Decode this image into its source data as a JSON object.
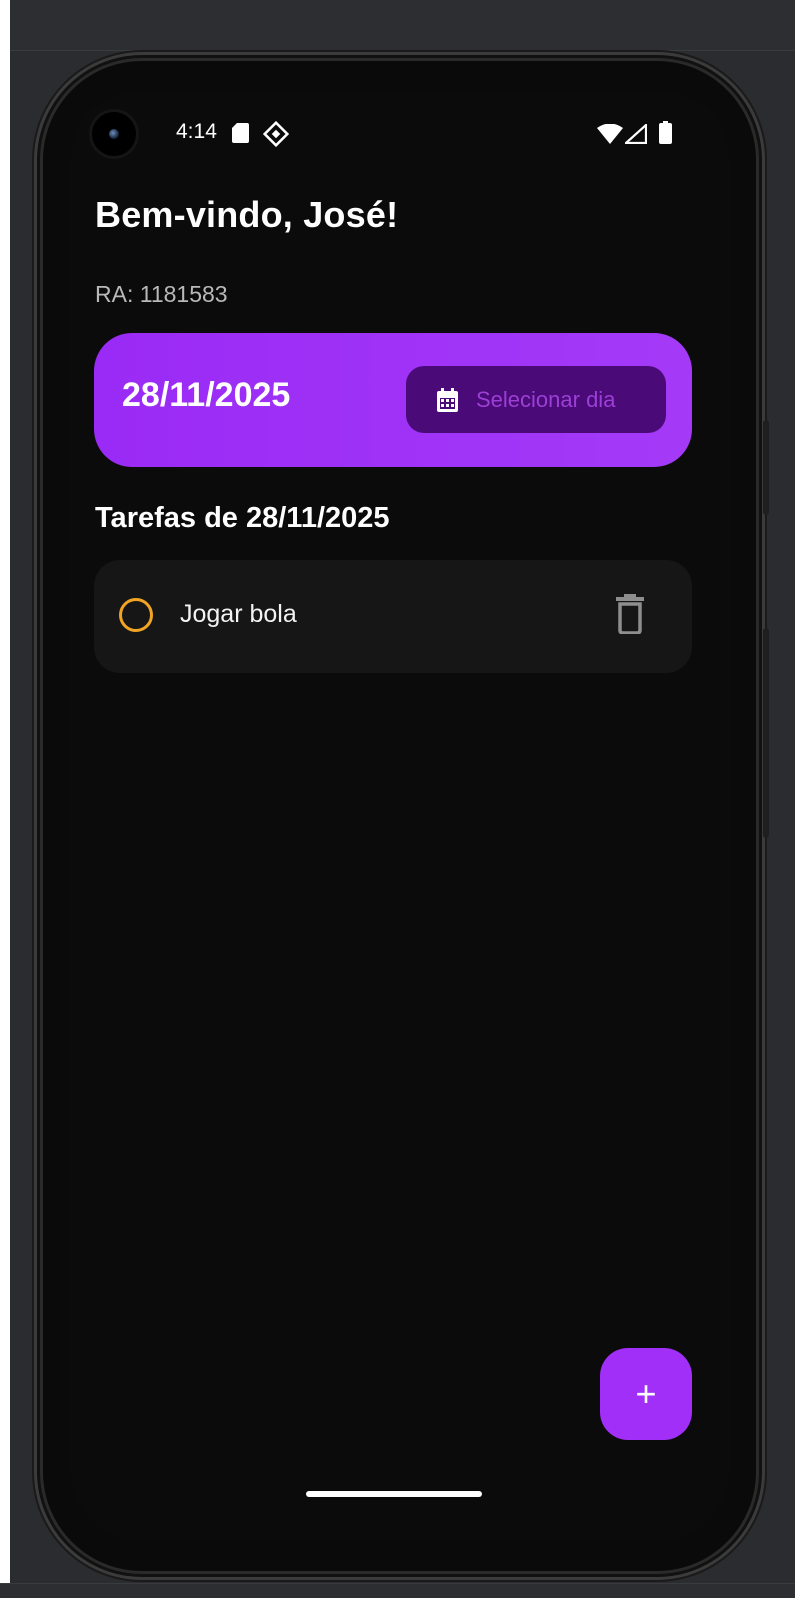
{
  "status_bar": {
    "time": "4:14",
    "icons": [
      "sd-card-icon",
      "game-controller-icon",
      "wifi-icon",
      "signal-icon",
      "battery-icon"
    ]
  },
  "header": {
    "welcome": "Bem-vindo, José!",
    "ra": "RA: 1181583"
  },
  "date_card": {
    "date": "28/11/2025",
    "select_button_label": "Selecionar dia",
    "button_icon": "calendar-icon"
  },
  "tasks": {
    "title": "Tarefas de 28/11/2025",
    "items": [
      {
        "label": "Jogar bola",
        "done": false,
        "delete_icon": "trash-icon"
      }
    ]
  },
  "fab": {
    "label": "+"
  },
  "colors": {
    "background": "#0b0b0b",
    "accent": "#9a2af5",
    "button_dark": "#4a0a77",
    "task_card": "#161616",
    "checkbox": "#f0a424"
  }
}
